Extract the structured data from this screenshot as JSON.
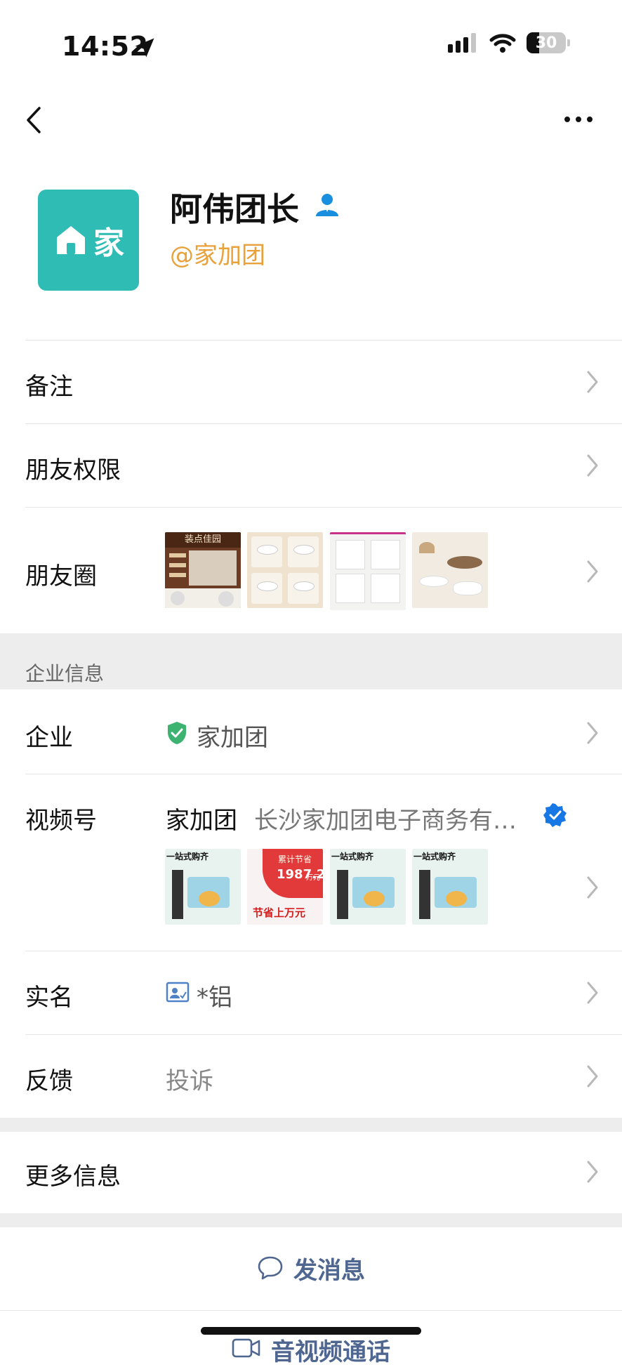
{
  "status_bar": {
    "time": "14:52",
    "battery": "30"
  },
  "profile": {
    "name": "阿伟团长",
    "org": "@家加团",
    "avatar_text": "家"
  },
  "rows": {
    "remark": "备注",
    "friend_permission": "朋友权限",
    "moments": "朋友圈",
    "more_info": "更多信息"
  },
  "enterprise_section": {
    "title": "企业信息",
    "company_label": "企业",
    "company_value": "家加团",
    "channel_label": "视频号",
    "channel_name": "家加团",
    "channel_desc": "长沙家加团电子商务有…",
    "realname_label": "实名",
    "realname_value": "*铝",
    "feedback_label": "反馈",
    "feedback_value": "投诉"
  },
  "video_thumbs": {
    "banner_text": "一站式购齐",
    "savings_label": "累计节省",
    "savings_value": "1987.2",
    "savings_unit": "万元",
    "promo_text": "节省上万元"
  },
  "moments_thumbs": {
    "first_title": "装点佳园"
  },
  "actions": {
    "send_message": "发消息",
    "video_call": "音视频通话"
  },
  "colors": {
    "avatar_bg": "#2fbcb5",
    "org_text": "#e9a23b",
    "link_blue": "#4f6790",
    "verified_blue": "#1677e5",
    "shield_green": "#3cb371"
  }
}
